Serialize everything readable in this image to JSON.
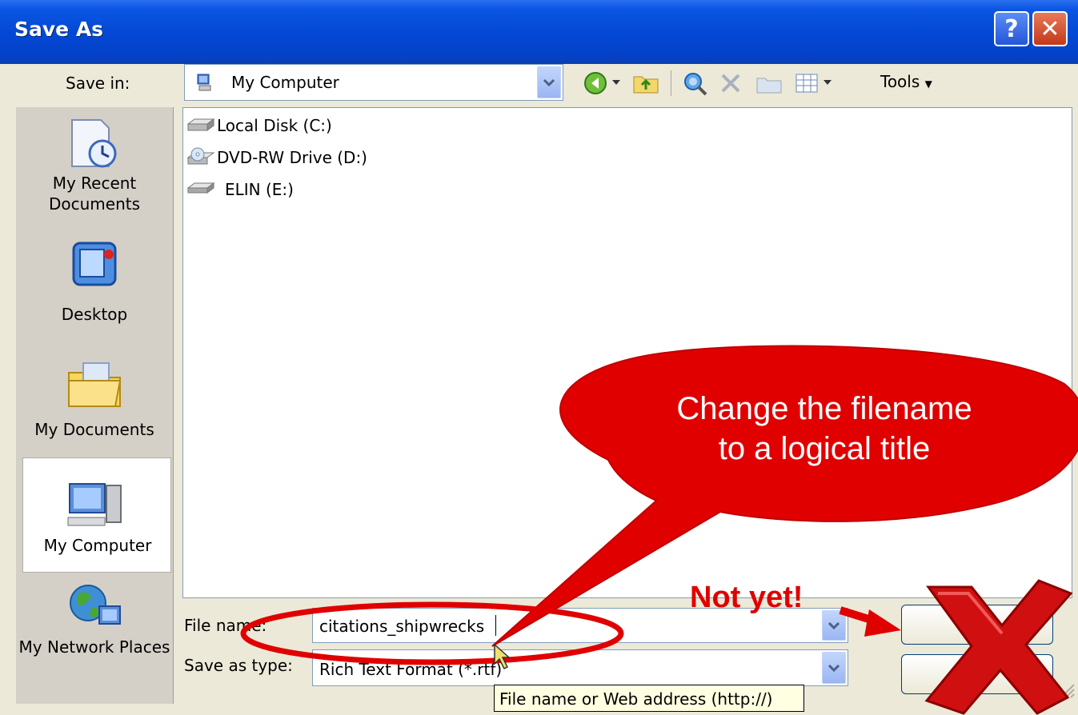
{
  "window": {
    "title": "Save As"
  },
  "title_buttons": {
    "help": "?",
    "close": "✕"
  },
  "save_in": {
    "label": "Save in:",
    "value": "My Computer"
  },
  "toolbar": {
    "tools_label": "Tools"
  },
  "places": [
    {
      "label": "My Recent Documents",
      "icon": "recent-documents-icon"
    },
    {
      "label": "Desktop",
      "icon": "desktop-icon"
    },
    {
      "label": "My Documents",
      "icon": "my-documents-icon"
    },
    {
      "label": "My Computer",
      "icon": "my-computer-icon",
      "selected": true
    },
    {
      "label": "My Network Places",
      "icon": "network-places-icon"
    }
  ],
  "files": [
    {
      "label": "Local Disk (C:)",
      "icon": "hard-disk-icon"
    },
    {
      "label": "DVD-RW Drive (D:)",
      "icon": "dvd-drive-icon"
    },
    {
      "label": "ELIN (E:)",
      "icon": "removable-drive-icon"
    }
  ],
  "file_name": {
    "label": "File name:",
    "value": "citations_shipwrecks"
  },
  "save_as_type": {
    "label": "Save as type:",
    "value": "Rich Text Format (*.rtf)"
  },
  "tooltip": "File name or Web address (http://)",
  "annotations": {
    "bubble_line1": "Change the filename",
    "bubble_line2": "to a logical title",
    "not_yet": "Not yet!"
  },
  "colors": {
    "title_bar": "#0347d4",
    "callout_red": "#e00000",
    "dialog_face": "#ece9d8"
  }
}
